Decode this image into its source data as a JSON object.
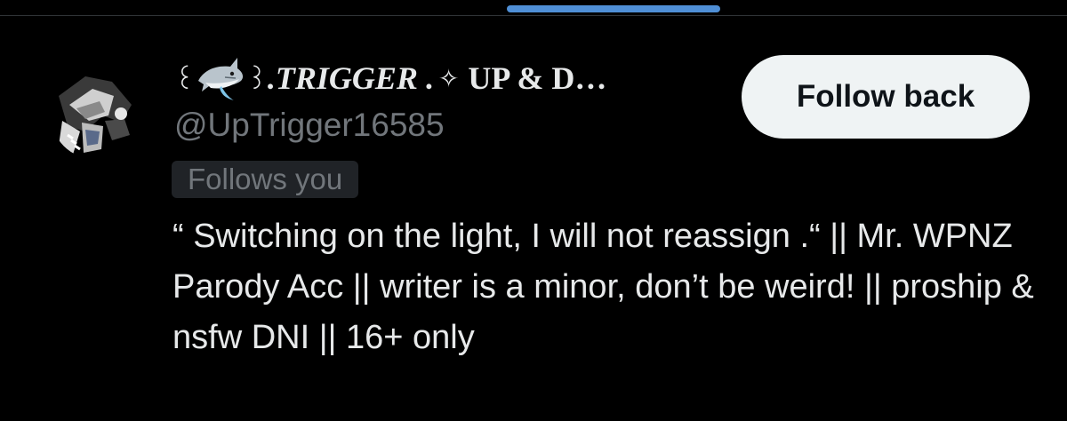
{
  "profile": {
    "name_prefix_symbol": "꒰",
    "name_after_icon_symbol": "꒱",
    "name_main": ".TRIGGER",
    "name_dot": ".",
    "name_spark": "✧",
    "name_tail": "UP & D…",
    "handle": "@UpTrigger16585",
    "follows_you": "Follows you",
    "bio": "“ Switching on the light, I will not reassign .“ || Mr. WPNZ Parody Acc || writer is a minor, don’t be weird! || proship & nsfw DNI || 16+ only",
    "icons": [
      "avatar",
      "shark-icon",
      "sparkle-icon"
    ]
  },
  "actions": {
    "follow_back_label": "Follow back"
  },
  "colors": {
    "background": "#000000",
    "text_primary": "#e7e9ea",
    "text_secondary": "#71767b",
    "badge_background": "#202327",
    "button_background": "#eff3f4",
    "button_text": "#0f1419",
    "scroll_indicator": "#4f8fd6"
  }
}
